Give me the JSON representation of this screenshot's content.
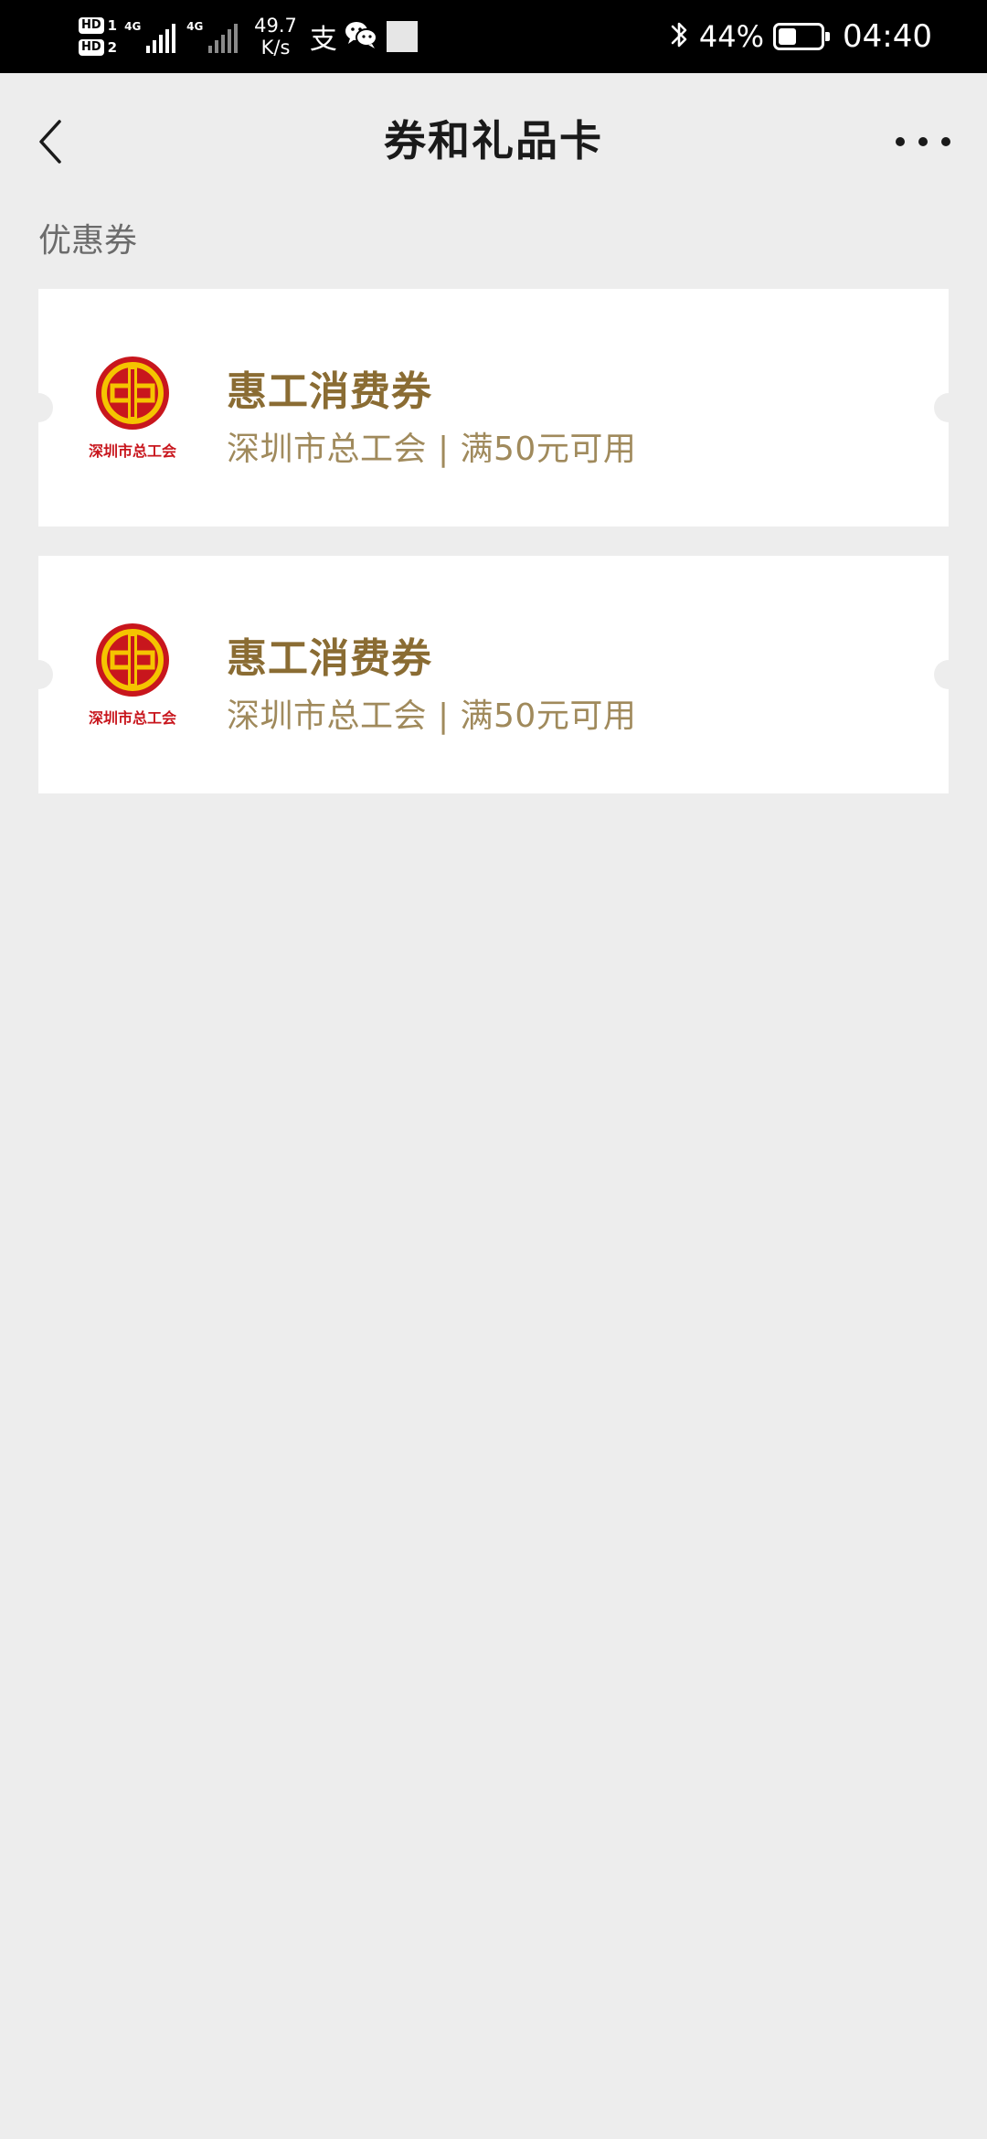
{
  "status_bar": {
    "hd1": "HD",
    "hd1_num": "1",
    "hd2": "HD",
    "hd2_num": "2",
    "net1": "4G",
    "net2": "4G",
    "speed_value": "49.7",
    "speed_unit": "K/s",
    "alipay_glyph": "支",
    "battery": "44%",
    "battery_level": 0.44,
    "time": "04:40",
    "icons": [
      "bluetooth-icon",
      "wechat-icon",
      "alipay-icon",
      "battery-icon"
    ]
  },
  "nav": {
    "title": "券和礼品卡",
    "back_icon": "chevron-left-icon",
    "more_icon": "more-dots-icon"
  },
  "section": {
    "title": "优惠券"
  },
  "coupons": [
    {
      "name": "惠工消费券",
      "desc": "深圳市总工会 | 满50元可用",
      "logo_text": "深圳市总工会",
      "logo_icon": "trade-union-logo-icon"
    },
    {
      "name": "惠工消费券",
      "desc": "深圳市总工会 | 满50元可用",
      "logo_text": "深圳市总工会",
      "logo_icon": "trade-union-logo-icon"
    }
  ],
  "colors": {
    "background": "#ededed",
    "card": "#ffffff",
    "coupon_name": "#8a6c33",
    "coupon_desc": "#a08a5c",
    "logo_red": "#c8161d",
    "logo_yellow": "#f5c400"
  }
}
